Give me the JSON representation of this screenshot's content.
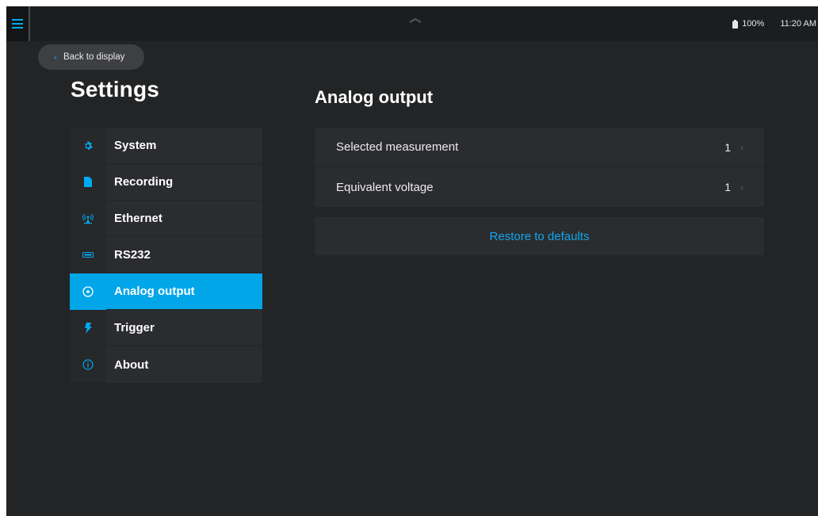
{
  "colors": {
    "accent": "#00a6e8",
    "background": "#232425",
    "panel": "#2b2c2f",
    "topbar": "#1c1d1f"
  },
  "topbar": {
    "menu_icon": "hamburger-menu-icon",
    "handle_icon": "chevron-up-icon",
    "battery_icon": "battery-icon",
    "battery_level": "100%",
    "time": "11:20 AM"
  },
  "back": {
    "label": "Back to display",
    "icon": "chevron-left-icon"
  },
  "page_title": "Settings",
  "sidebar": {
    "items": [
      {
        "label": "System",
        "icon": "gear-icon",
        "active": false
      },
      {
        "label": "Recording",
        "icon": "file-icon",
        "active": false
      },
      {
        "label": "Ethernet",
        "icon": "antenna-icon",
        "active": false
      },
      {
        "label": "RS232",
        "icon": "serial-port-icon",
        "active": false
      },
      {
        "label": "Analog output",
        "icon": "target-circle-icon",
        "active": true
      },
      {
        "label": "Trigger",
        "icon": "lightning-icon",
        "active": false
      },
      {
        "label": "About",
        "icon": "info-icon",
        "active": false
      }
    ]
  },
  "main": {
    "title": "Analog output",
    "rows": [
      {
        "label": "Selected measurement",
        "value": "1"
      },
      {
        "label": "Equivalent voltage",
        "value": "1"
      }
    ],
    "restore_label": "Restore to defaults"
  }
}
